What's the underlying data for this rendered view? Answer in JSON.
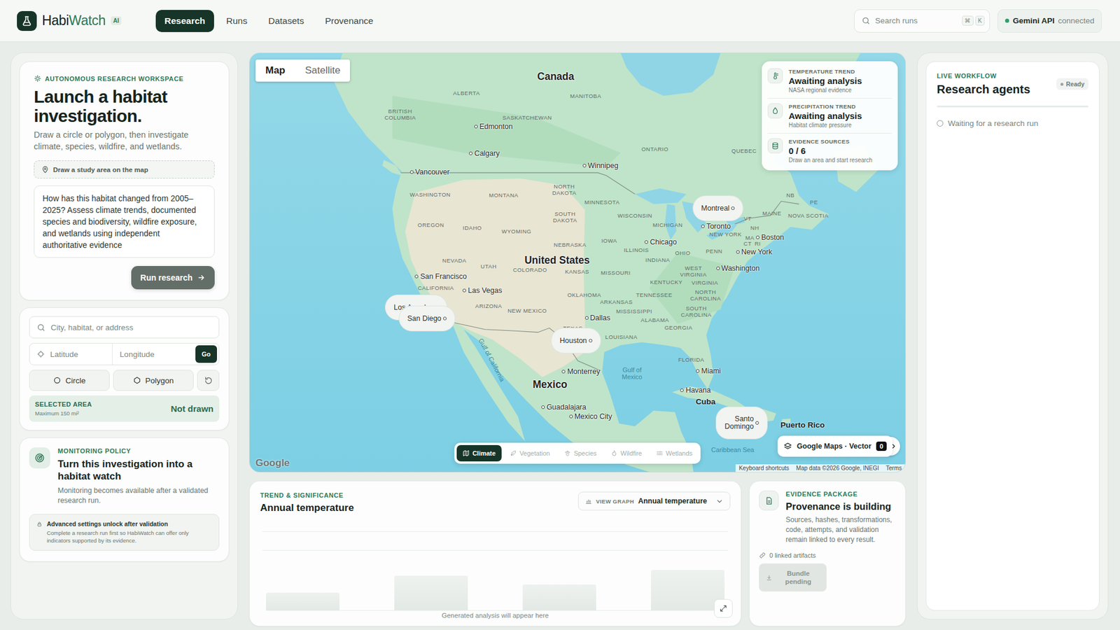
{
  "nav": {
    "brand_primary": "Habi",
    "brand_accent": "Watch",
    "badge": "AI",
    "tabs": [
      {
        "label": "Research",
        "selected": true
      },
      {
        "label": "Runs",
        "selected": false
      },
      {
        "label": "Datasets",
        "selected": false
      },
      {
        "label": "Provenance",
        "selected": false
      }
    ],
    "search": {
      "placeholder": "Search runs",
      "shortcut": [
        "⌘",
        "K"
      ]
    },
    "status": {
      "label": "Gemini API",
      "state": "connected",
      "connected": true
    }
  },
  "launch": {
    "eyebrow": "AUTONOMOUS RESEARCH WORKSPACE",
    "title": "Launch a habitat investigation.",
    "subtitle": "Draw a circle or polygon, then investigate climate, species, wildfire, and wetlands.",
    "hint": "Draw a study area on the map",
    "prompt": "How has this habitat changed from 2005–2025? Assess climate trends, documented species and biodiversity, wildfire exposure, and wetlands using independent authoritative evidence",
    "button": "Run research",
    "button_disabled": true
  },
  "location": {
    "search_placeholder": "City, habitat, or address",
    "latitude_placeholder": "Latitude",
    "longitude_placeholder": "Longitude",
    "go": "Go",
    "tools": [
      {
        "label": "Circle",
        "selected": false
      },
      {
        "label": "Polygon",
        "selected": false
      }
    ],
    "area_label": "SELECTED AREA",
    "area_limit": "Maximum 150 mi²",
    "area_value": "Not drawn"
  },
  "monitoring": {
    "eyebrow": "MONITORING POLICY",
    "title": "Turn this investigation into a habitat watch",
    "body": "Monitoring becomes available after a validated research run.",
    "locked_title": "Advanced settings unlock after validation",
    "locked_body": "Complete a research run first so HabiWatch can offer only indicators supported by its evidence."
  },
  "map": {
    "view_modes": [
      {
        "label": "Map",
        "selected": true
      },
      {
        "label": "Satellite",
        "selected": false
      }
    ],
    "summary": [
      {
        "label": "TEMPERATURE TREND",
        "value": "Awaiting analysis",
        "note": "NASA regional evidence"
      },
      {
        "label": "PRECIPITATION TREND",
        "value": "Awaiting analysis",
        "note": "Habitat climate pressure"
      },
      {
        "label": "EVIDENCE SOURCES",
        "value": "0 / 6",
        "note": "Draw an area and start research"
      }
    ],
    "layers": [
      {
        "label": "Climate",
        "selected": true,
        "disabled": false
      },
      {
        "label": "Vegetation",
        "selected": false,
        "disabled": true
      },
      {
        "label": "Species",
        "selected": false,
        "disabled": true
      },
      {
        "label": "Wildfire",
        "selected": false,
        "disabled": true
      },
      {
        "label": "Wetlands",
        "selected": false,
        "disabled": true
      }
    ],
    "provider": {
      "label": "Google Maps · Vector",
      "badge": "0"
    },
    "logo": "Google",
    "attribution": [
      "Keyboard shortcuts",
      "Map data ©2026 Google, INEGI",
      "Terms"
    ],
    "labels": {
      "countries": [
        "Canada",
        "United States",
        "Mexico"
      ],
      "islands": [
        "Cuba",
        "Puerto Rico"
      ],
      "cities": [
        "Edmonton",
        "Calgary",
        "Vancouver",
        "Winnipeg",
        "Montreal",
        "Toronto",
        "Boston",
        "New York",
        "Chicago",
        "Washington",
        "San Francisco",
        "Las Vegas",
        "Los Angeles",
        "San Diego",
        "Dallas",
        "Houston",
        "Monterrey",
        "Miami",
        "Havana",
        "Guadalajara",
        "Mexico City",
        "Santo Domingo"
      ],
      "regions": [
        "BRITISH COLUMBIA",
        "ALBERTA",
        "SASKATCHEWAN",
        "MANITOBA",
        "ONTARIO",
        "QUEBEC",
        "WASHINGTON",
        "MONTANA",
        "NORTH DAKOTA",
        "MINNESOTA",
        "OREGON",
        "IDAHO",
        "WYOMING",
        "SOUTH DAKOTA",
        "WISCONSIN",
        "MICHIGAN",
        "NEBRASKA",
        "IOWA",
        "ILLINOIS",
        "NEVADA",
        "UTAH",
        "COLORADO",
        "KANSAS",
        "MISSOURI",
        "INDIANA",
        "OHIO",
        "PENN",
        "NEW YORK",
        "CALIFORNIA",
        "ARIZONA",
        "NEW MEXICO",
        "OKLAHOMA",
        "ARKANSAS",
        "TENNESSEE",
        "KENTUCKY",
        "WEST VIRGINIA",
        "VIRGINIA",
        "NORTH CAROLINA",
        "SOUTH CAROLINA",
        "MISSISSIPPI",
        "ALABAMA",
        "GEORGIA",
        "TEXAS",
        "LOUISIANA",
        "FLORIDA",
        "MAINE",
        "VT",
        "NH",
        "MA",
        "CT",
        "RI",
        "NB",
        "PE",
        "NOVA SCOTIA"
      ],
      "water": [
        "Gulf of Mexico",
        "Gulf of California",
        "Caribbean Sea"
      ]
    }
  },
  "trend": {
    "eyebrow": "TREND & SIGNIFICANCE",
    "title": "Annual temperature",
    "selector_label": "VIEW GRAPH",
    "selector_value": "Annual temperature",
    "placeholder_bars": [
      0.31,
      0.6,
      0.45,
      0.7
    ],
    "empty_text": "Generated analysis will appear here"
  },
  "evidence": {
    "eyebrow": "EVIDENCE PACKAGE",
    "title": "Provenance is building",
    "body": "Sources, hashes, transformations, code, attempts, and validation remain linked to every result.",
    "artifacts": "0 linked artifacts",
    "button": "Bundle pending",
    "button_disabled": true
  },
  "workflow": {
    "eyebrow": "LIVE WORKFLOW",
    "title": "Research agents",
    "status": "Ready",
    "steps": [
      {
        "label": "Waiting for a research run",
        "done": false
      }
    ]
  }
}
